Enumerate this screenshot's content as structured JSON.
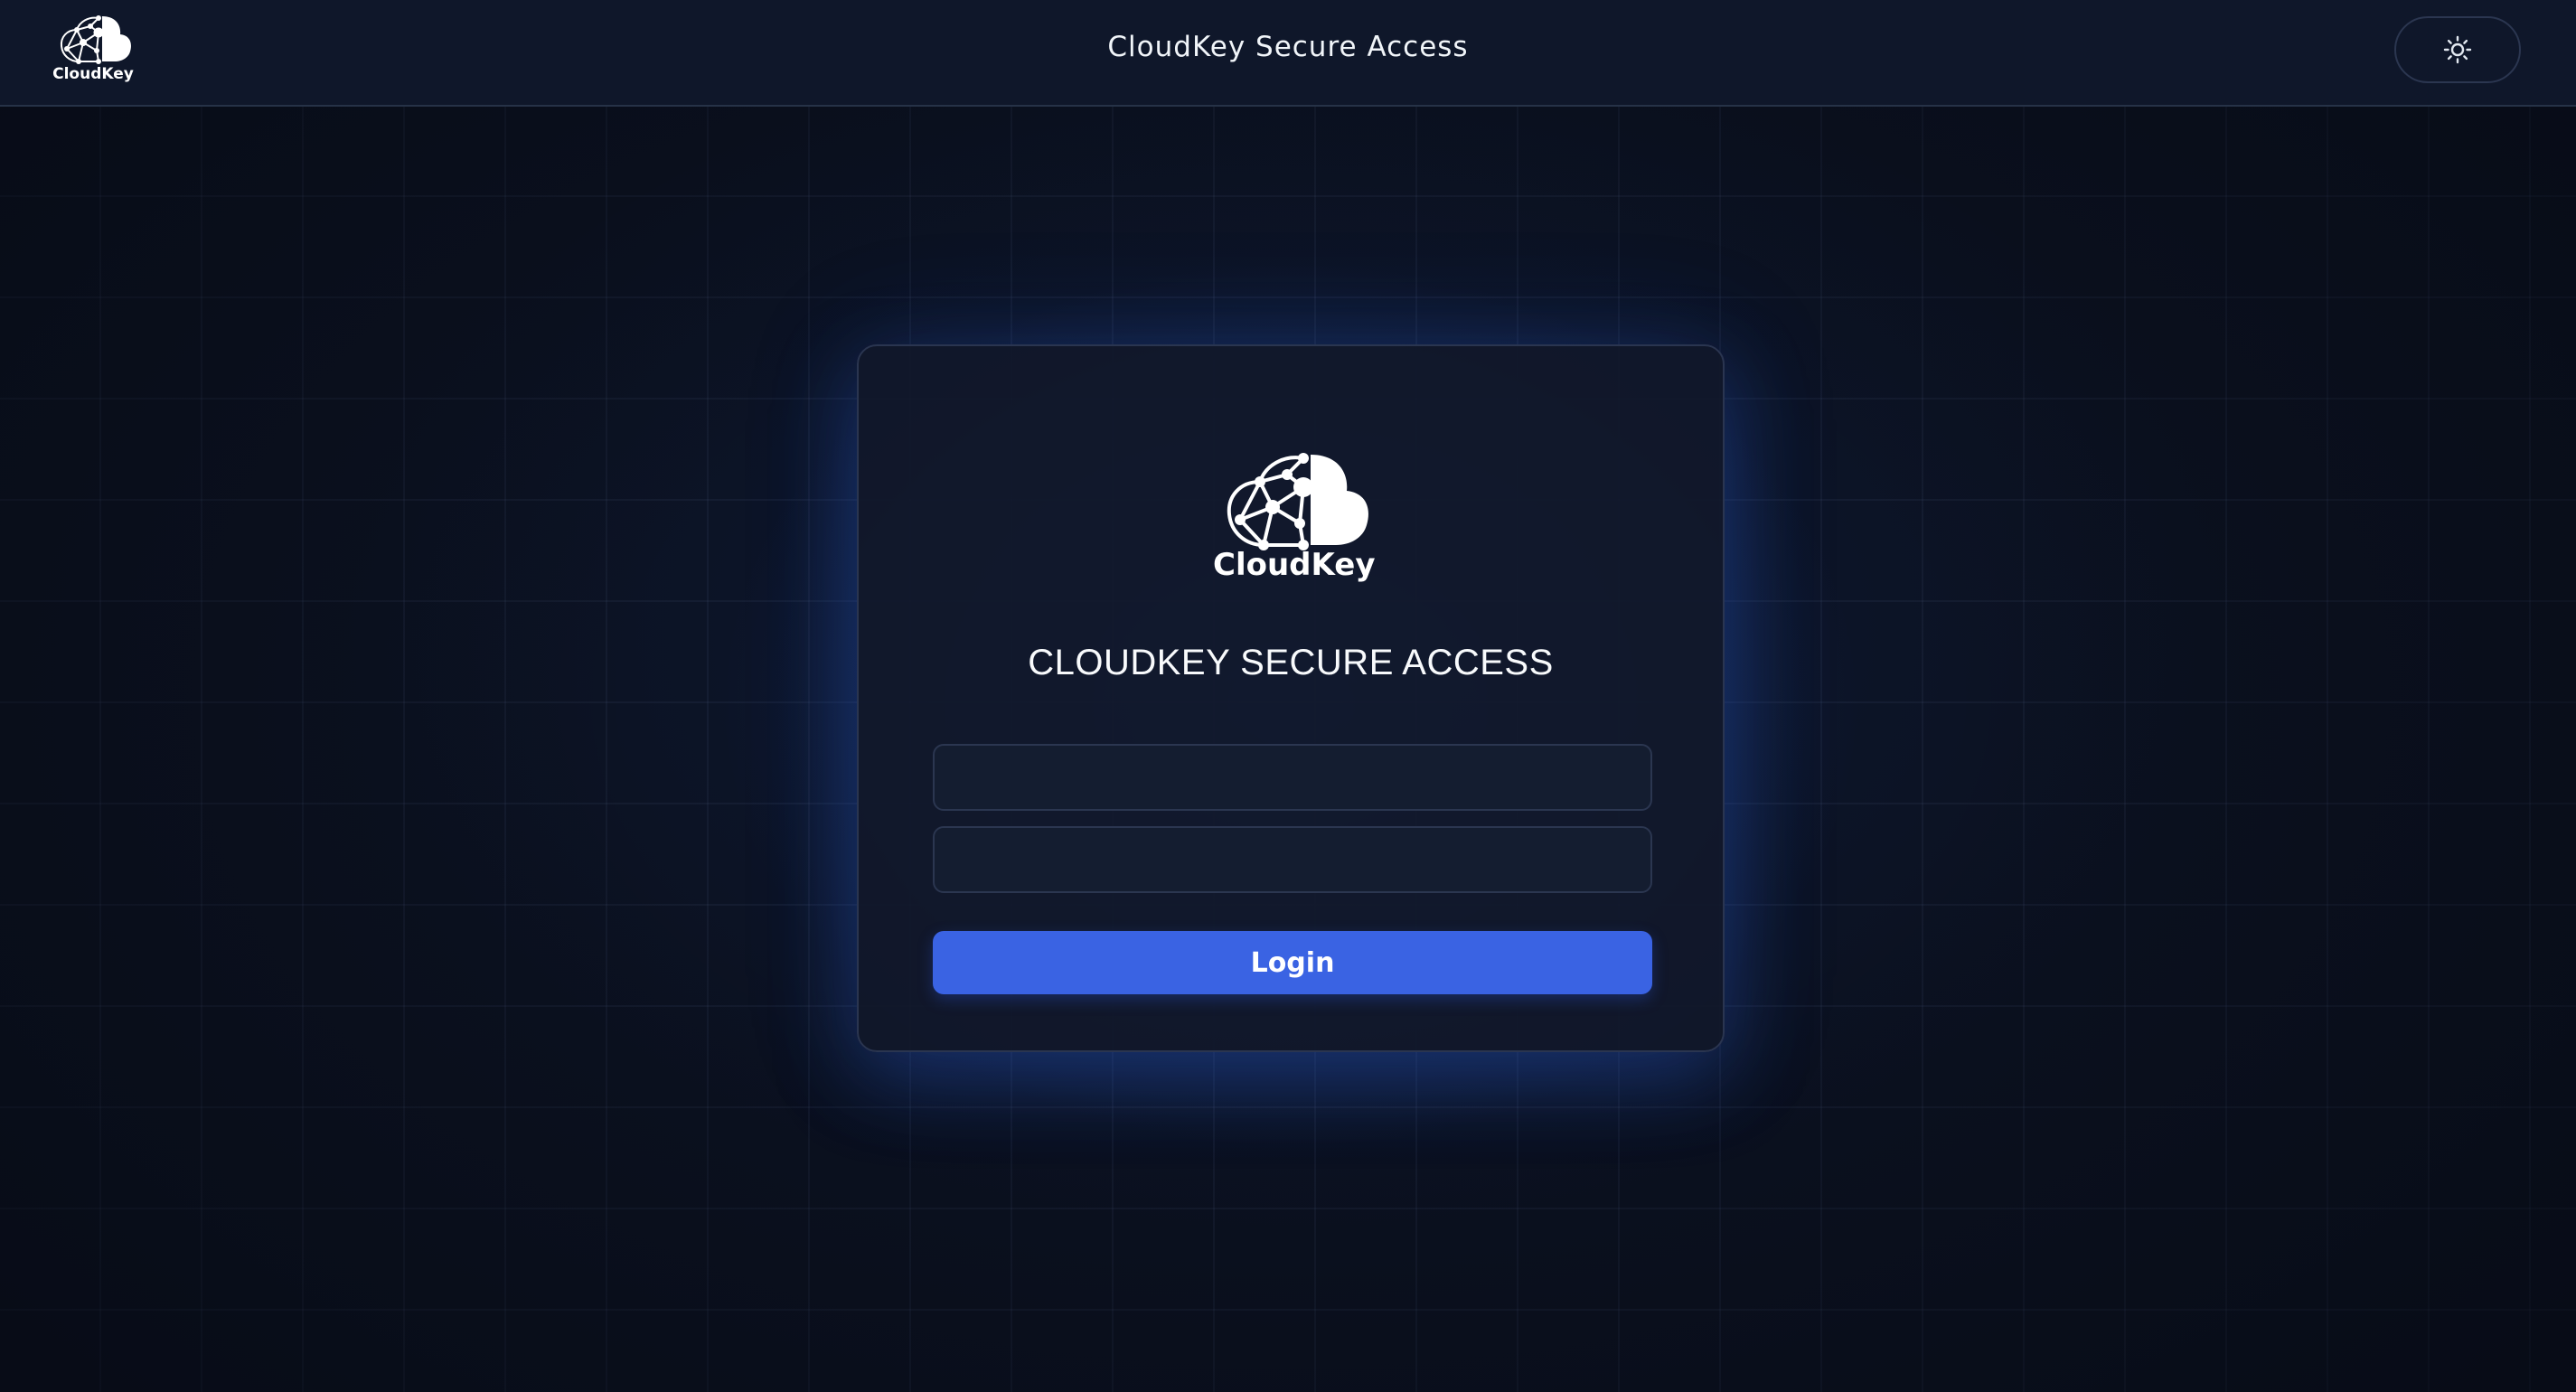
{
  "header": {
    "logo_text": "CloudKey",
    "title": "CloudKey Secure Access",
    "theme_toggle_icon": "sun-icon"
  },
  "card": {
    "logo_text": "CloudKey",
    "title": "CLOUDKEY SECURE ACCESS",
    "username": {
      "value": "",
      "placeholder": ""
    },
    "password": {
      "value": "",
      "placeholder": ""
    },
    "login_label": "Login"
  },
  "colors": {
    "background": "#0b1120",
    "header": "#0f172a",
    "card": "#11182a",
    "accent": "#3a63e3",
    "text": "#f1f5f9"
  }
}
